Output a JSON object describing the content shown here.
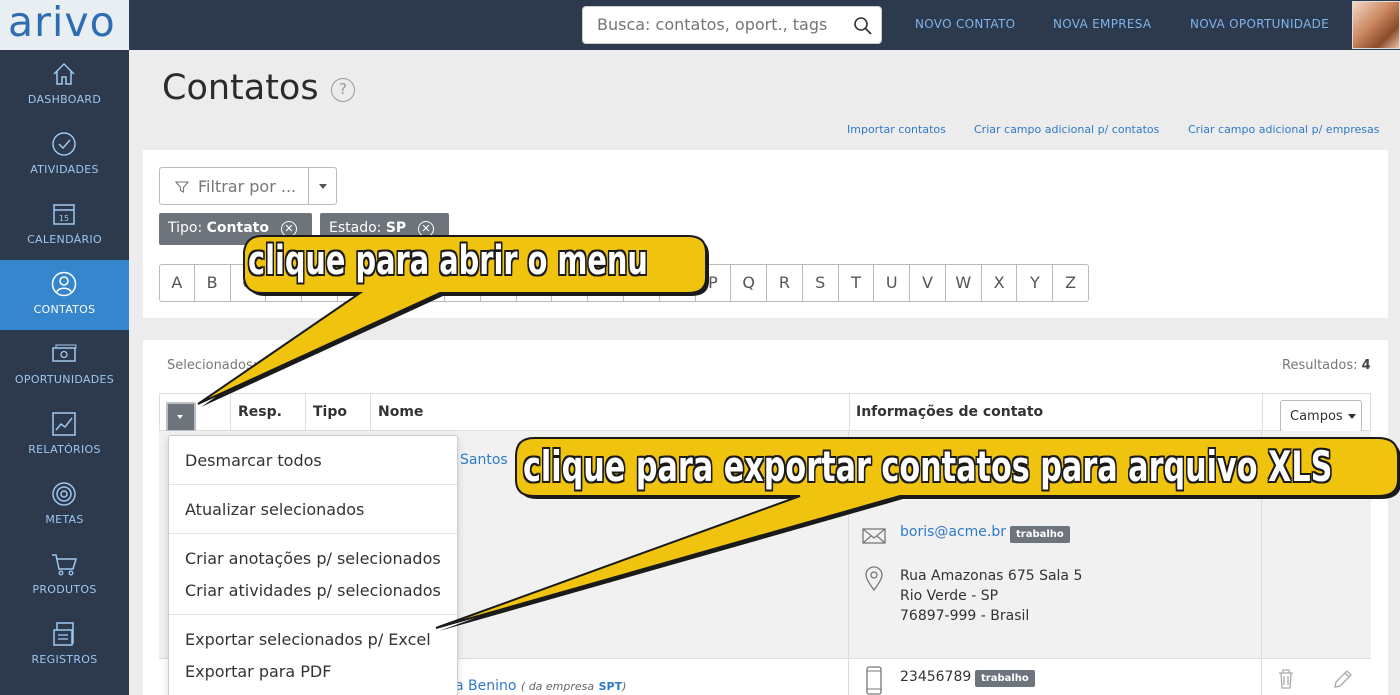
{
  "app": {
    "logo": "arivo"
  },
  "search": {
    "placeholder": "Busca: contatos, oport., tags"
  },
  "topnav": {
    "new_contact": "NOVO CONTATO",
    "new_company": "NOVA EMPRESA",
    "new_opportunity": "NOVA OPORTUNIDADE"
  },
  "sidebar": {
    "items": [
      {
        "label": "DASHBOARD",
        "icon": "home-icon"
      },
      {
        "label": "ATIVIDADES",
        "icon": "check-circle-icon"
      },
      {
        "label": "CALENDÁRIO",
        "icon": "calendar-icon",
        "day": "15"
      },
      {
        "label": "CONTATOS",
        "icon": "user-icon",
        "active": true
      },
      {
        "label": "OPORTUNIDADES",
        "icon": "money-icon"
      },
      {
        "label": "RELATÓRIOS",
        "icon": "chart-icon"
      },
      {
        "label": "METAS",
        "icon": "target-icon"
      },
      {
        "label": "PRODUTOS",
        "icon": "cart-icon"
      },
      {
        "label": "REGISTROS",
        "icon": "records-icon"
      }
    ]
  },
  "page": {
    "title": "Contatos",
    "help": "?",
    "links": {
      "import": "Importar contatos",
      "extra_contacts": "Criar campo adicional p/ contatos",
      "extra_companies": "Criar campo adicional p/ empresas"
    }
  },
  "filter": {
    "label": "Filtrar por ...",
    "tags": [
      {
        "key": "Tipo:",
        "value": "Contato"
      },
      {
        "key": "Estado:",
        "value": "SP"
      }
    ],
    "letters": [
      "A",
      "B",
      "C",
      "D",
      "E",
      "F",
      "G",
      "H",
      "I",
      "J",
      "K",
      "L",
      "M",
      "N",
      "O",
      "P",
      "Q",
      "R",
      "S",
      "T",
      "U",
      "V",
      "W",
      "X",
      "Y",
      "Z"
    ]
  },
  "results": {
    "selected_label": "Selecionados:",
    "results_label": "Resultados:",
    "results_count": "4"
  },
  "table": {
    "headers": {
      "resp": "Resp.",
      "tipo": "Tipo",
      "nome": "Nome",
      "info": "Informações de contato"
    },
    "campos_button": "Campos"
  },
  "rows": [
    {
      "name_fragment": "Santos",
      "email": "boris@acme.br",
      "email_tag": "trabalho",
      "address_line1": "Rua Amazonas 675 Sala 5",
      "address_line2": "Rio Verde - SP",
      "address_line3": "76897-999 - Brasil"
    },
    {
      "name_fragment": "a Benino",
      "company_prefix": "( da empresa",
      "company": "SPT",
      "company_suffix": ")",
      "phone": "23456789",
      "phone_tag": "trabalho"
    }
  ],
  "bulk_menu": {
    "items": [
      "Desmarcar todos",
      "Atualizar selecionados",
      "Criar anotações p/ selecionados",
      "Criar atividades p/ selecionados",
      "Exportar selecionados p/ Excel",
      "Exportar para PDF"
    ]
  },
  "callouts": {
    "open_menu": "clique para abrir o menu",
    "export_xls": "clique para exportar contatos para arquivo XLS",
    "fill_color": "#f0c30f"
  }
}
